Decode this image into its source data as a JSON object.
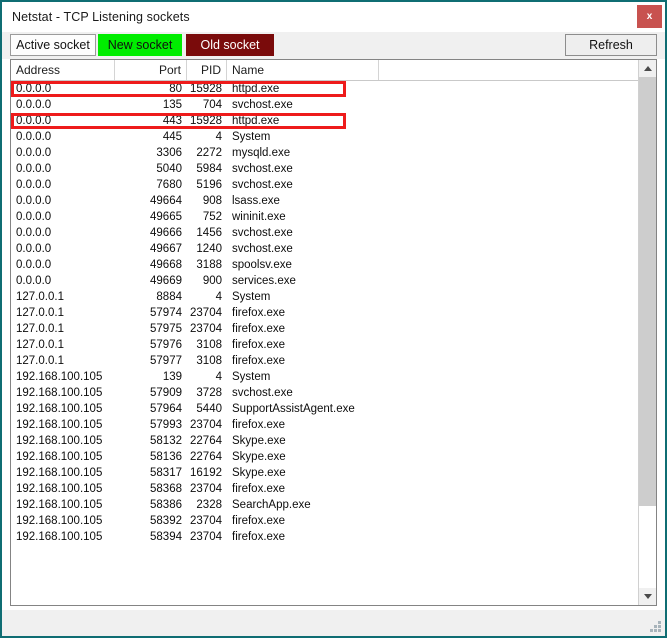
{
  "window": {
    "title": "Netstat - TCP Listening sockets",
    "close_label": "x",
    "border_color": "#0f6d73",
    "close_color": "#c8524f"
  },
  "toolbar": {
    "tabs": [
      {
        "label": "Active socket",
        "name": "active-socket",
        "bg": "#fdfdfd",
        "fg": "#121212"
      },
      {
        "label": "New socket",
        "name": "new-socket",
        "bg": "#00ed00",
        "fg": "#101010"
      },
      {
        "label": "Old socket",
        "name": "old-socket",
        "bg": "#7a0b0b",
        "fg": "#ffffff"
      }
    ],
    "refresh_label": "Refresh"
  },
  "table": {
    "columns": [
      "Address",
      "Port",
      "PID",
      "Name"
    ],
    "highlight_color": "#ee1b1b",
    "highlighted_rows": [
      0,
      2
    ],
    "rows": [
      {
        "address": "0.0.0.0",
        "port": "80",
        "pid": "15928",
        "name": "httpd.exe"
      },
      {
        "address": "0.0.0.0",
        "port": "135",
        "pid": "704",
        "name": "svchost.exe"
      },
      {
        "address": "0.0.0.0",
        "port": "443",
        "pid": "15928",
        "name": "httpd.exe"
      },
      {
        "address": "0.0.0.0",
        "port": "445",
        "pid": "4",
        "name": "System"
      },
      {
        "address": "0.0.0.0",
        "port": "3306",
        "pid": "2272",
        "name": "mysqld.exe"
      },
      {
        "address": "0.0.0.0",
        "port": "5040",
        "pid": "5984",
        "name": "svchost.exe"
      },
      {
        "address": "0.0.0.0",
        "port": "7680",
        "pid": "5196",
        "name": "svchost.exe"
      },
      {
        "address": "0.0.0.0",
        "port": "49664",
        "pid": "908",
        "name": "lsass.exe"
      },
      {
        "address": "0.0.0.0",
        "port": "49665",
        "pid": "752",
        "name": "wininit.exe"
      },
      {
        "address": "0.0.0.0",
        "port": "49666",
        "pid": "1456",
        "name": "svchost.exe"
      },
      {
        "address": "0.0.0.0",
        "port": "49667",
        "pid": "1240",
        "name": "svchost.exe"
      },
      {
        "address": "0.0.0.0",
        "port": "49668",
        "pid": "3188",
        "name": "spoolsv.exe"
      },
      {
        "address": "0.0.0.0",
        "port": "49669",
        "pid": "900",
        "name": "services.exe"
      },
      {
        "address": "127.0.0.1",
        "port": "8884",
        "pid": "4",
        "name": "System"
      },
      {
        "address": "127.0.0.1",
        "port": "57974",
        "pid": "23704",
        "name": "firefox.exe"
      },
      {
        "address": "127.0.0.1",
        "port": "57975",
        "pid": "23704",
        "name": "firefox.exe"
      },
      {
        "address": "127.0.0.1",
        "port": "57976",
        "pid": "3108",
        "name": "firefox.exe"
      },
      {
        "address": "127.0.0.1",
        "port": "57977",
        "pid": "3108",
        "name": "firefox.exe"
      },
      {
        "address": "192.168.100.105",
        "port": "139",
        "pid": "4",
        "name": "System"
      },
      {
        "address": "192.168.100.105",
        "port": "57909",
        "pid": "3728",
        "name": "svchost.exe"
      },
      {
        "address": "192.168.100.105",
        "port": "57964",
        "pid": "5440",
        "name": "SupportAssistAgent.exe"
      },
      {
        "address": "192.168.100.105",
        "port": "57993",
        "pid": "23704",
        "name": "firefox.exe"
      },
      {
        "address": "192.168.100.105",
        "port": "58132",
        "pid": "22764",
        "name": "Skype.exe"
      },
      {
        "address": "192.168.100.105",
        "port": "58136",
        "pid": "22764",
        "name": "Skype.exe"
      },
      {
        "address": "192.168.100.105",
        "port": "58317",
        "pid": "16192",
        "name": "Skype.exe"
      },
      {
        "address": "192.168.100.105",
        "port": "58368",
        "pid": "23704",
        "name": "firefox.exe"
      },
      {
        "address": "192.168.100.105",
        "port": "58386",
        "pid": "2328",
        "name": "SearchApp.exe"
      },
      {
        "address": "192.168.100.105",
        "port": "58392",
        "pid": "23704",
        "name": "firefox.exe"
      },
      {
        "address": "192.168.100.105",
        "port": "58394",
        "pid": "23704",
        "name": "firefox.exe"
      }
    ]
  },
  "scrollbar": {
    "up_icon": "scroll-up-icon",
    "down_icon": "scroll-down-icon"
  }
}
